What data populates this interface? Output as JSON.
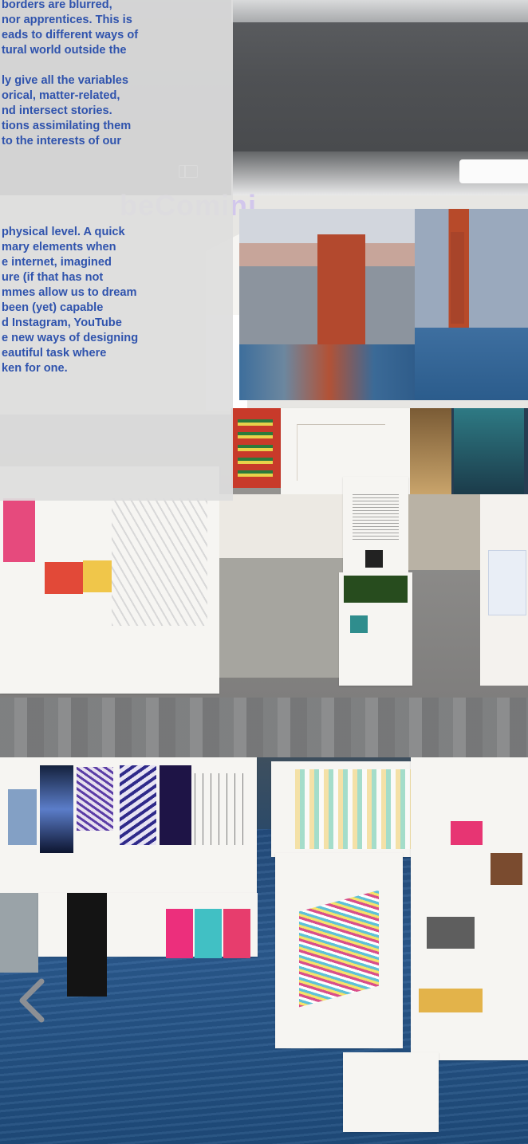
{
  "overlay_text": {
    "paragraph_1": [
      "borders are blurred,",
      "nor apprentices. This is",
      "eads to different ways of",
      "tural world outside the"
    ],
    "paragraph_2": [
      "ly give all the variables",
      "orical, matter-related,",
      "nd intersect stories.",
      "tions assimilating them",
      "to the interests of our"
    ],
    "paragraph_3": [
      "physical level. A quick",
      "mary elements when",
      "e internet, imagined",
      "ure (if that has not",
      "mmes allow us to dream",
      "been (yet) capable",
      "d Instagram, YouTube",
      "e new ways of designing",
      "eautiful task where",
      "ken for one."
    ]
  },
  "watermark": "beCominj",
  "icons": {
    "sidebar": "sidebar-toggle-icon",
    "back": "chevron-left-icon"
  },
  "colors": {
    "overlay_text": "#2f53ad",
    "overlay_bg": "#dedede",
    "sea": "#2a5a8f"
  }
}
